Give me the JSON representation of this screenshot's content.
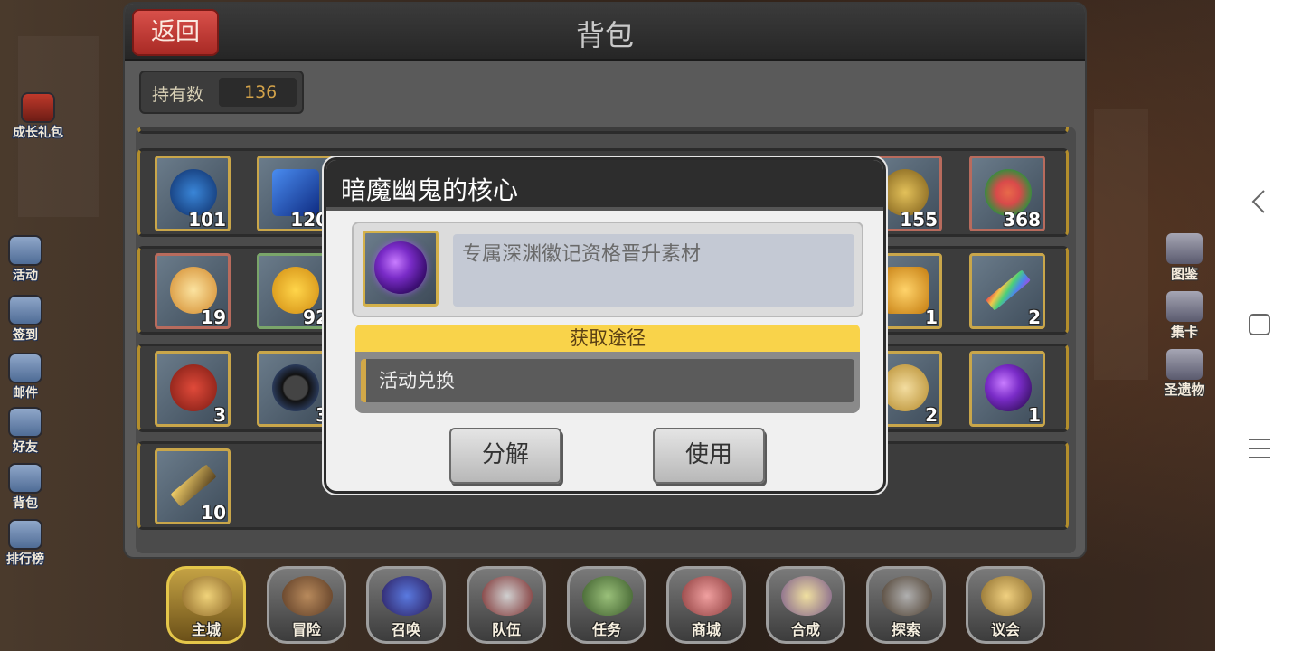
{
  "bag": {
    "back_label": "返回",
    "title": "背包",
    "hold_label": "持有数",
    "hold_value": "136"
  },
  "left_menu": [
    {
      "label": "成长礼包",
      "icon": "gift-icon"
    },
    {
      "label": "活动",
      "icon": "activity-icon"
    },
    {
      "label": "签到",
      "icon": "checkin-icon"
    },
    {
      "label": "邮件",
      "icon": "mail-icon"
    },
    {
      "label": "好友",
      "icon": "friends-icon"
    },
    {
      "label": "背包",
      "icon": "bag-icon"
    },
    {
      "label": "排行榜",
      "icon": "ranking-icon"
    }
  ],
  "right_menu": [
    {
      "label": "图鉴",
      "icon": "book-icon"
    },
    {
      "label": "集卡",
      "icon": "card-icon"
    },
    {
      "label": "圣遗物",
      "icon": "relic-icon"
    }
  ],
  "item_rows": [
    {
      "items": [
        {
          "count": "101",
          "icon": "blue-creature-icon"
        },
        {
          "count": "120",
          "icon": "blue-crystal-icon"
        },
        {
          "count": "155",
          "icon": "golden-hammer-icon"
        },
        {
          "count": "368",
          "icon": "flower-icon"
        }
      ]
    },
    {
      "items": [
        {
          "count": "19",
          "icon": "cake-icon"
        },
        {
          "count": "92",
          "icon": "fruit-icon"
        },
        {
          "count": "1",
          "icon": "honey-jar-icon"
        },
        {
          "count": "2",
          "icon": "rainbow-sword-icon"
        }
      ]
    },
    {
      "items": [
        {
          "count": "3",
          "icon": "red-bag-icon"
        },
        {
          "count": "3",
          "icon": "dark-ring-icon"
        },
        {
          "count": "2",
          "icon": "gold-coin-icon"
        },
        {
          "count": "1",
          "icon": "purple-orb-icon"
        }
      ]
    },
    {
      "items": [
        {
          "count": "10",
          "icon": "golden-spear-icon"
        }
      ]
    }
  ],
  "dock": [
    {
      "label": "主城",
      "active": true
    },
    {
      "label": "冒险",
      "active": false
    },
    {
      "label": "召唤",
      "active": false
    },
    {
      "label": "队伍",
      "active": false
    },
    {
      "label": "任务",
      "active": false
    },
    {
      "label": "商城",
      "active": false
    },
    {
      "label": "合成",
      "active": false
    },
    {
      "label": "探索",
      "active": false
    },
    {
      "label": "议会",
      "active": false
    }
  ],
  "dialog": {
    "title": "暗魔幽鬼的核心",
    "description": "专属深渊徽记资格晋升素材",
    "source_header": "获取途径",
    "source_item": "活动兑换",
    "decompose_label": "分解",
    "use_label": "使用",
    "item_icon": "purple-orb-icon"
  },
  "navbar": {
    "back_icon": "back-chevron-icon",
    "home_icon": "home-square-icon",
    "recents_icon": "menu-lines-icon"
  },
  "colors": {
    "dialog_header": "#2d2d2d",
    "source_header": "#f9d34a",
    "back_button": "#c23a34",
    "slot_border": "#c9a64a",
    "orb": "#7a2cc8"
  }
}
